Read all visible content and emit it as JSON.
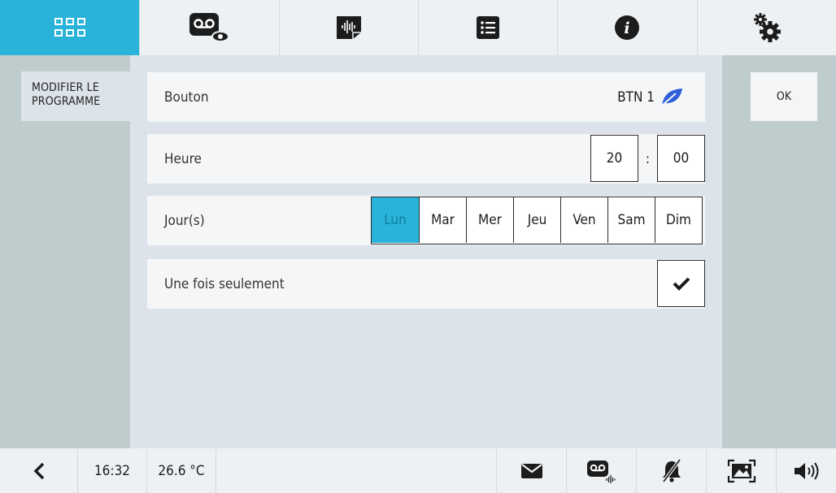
{
  "top_tabs": [
    {
      "name": "apps-grid-icon",
      "active": true
    },
    {
      "name": "video-message-view-icon",
      "active": false
    },
    {
      "name": "audio-message-icon",
      "active": false
    },
    {
      "name": "list-icon",
      "active": false
    },
    {
      "name": "info-icon",
      "active": false
    },
    {
      "name": "settings-gears-icon",
      "active": false
    }
  ],
  "side": {
    "title": "MODIFIER LE PROGRAMME"
  },
  "ok_label": "OK",
  "form": {
    "button_label": "Bouton",
    "button_value": "BTN 1",
    "hour_label": "Heure",
    "hour": "20",
    "separator": ":",
    "minute": "00",
    "days_label": "Jour(s)",
    "days": [
      "Lun",
      "Mar",
      "Mer",
      "Jeu",
      "Ven",
      "Sam",
      "Dim"
    ],
    "selected_day": "Lun",
    "once_label": "Une fois seulement",
    "once_checked": true
  },
  "bottom": {
    "back_icon": "chevron-left-icon",
    "time": "16:32",
    "temperature": "26.6 °C",
    "icons": [
      "envelope-icon",
      "video-message-audio-icon",
      "bell-muted-icon",
      "image-frame-icon",
      "speaker-icon"
    ]
  },
  "colors": {
    "accent": "#29b3d9",
    "leaf": "#2f5ed8",
    "side_panel": "#bfccce",
    "background": "#dde3ea"
  }
}
